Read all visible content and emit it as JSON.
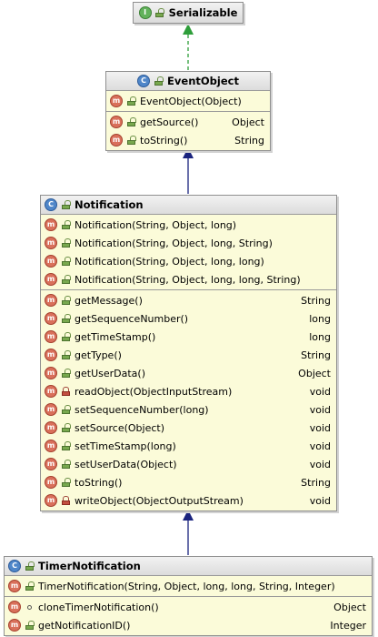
{
  "colors": {
    "box_bg": "#fbfbd9",
    "extends_arrow": "#1a237e",
    "implements_arrow": "#2e9e3a"
  },
  "serializable": {
    "title": "Serializable",
    "kind": "interface"
  },
  "event_object": {
    "title": "EventObject",
    "constructors": [
      {
        "name": "EventObject(Object)"
      }
    ],
    "methods": [
      {
        "name": "getSource()",
        "type": "Object",
        "visibility": "public"
      },
      {
        "name": "toString()",
        "type": "String",
        "visibility": "public"
      }
    ]
  },
  "notification": {
    "title": "Notification",
    "constructors": [
      {
        "name": "Notification(String, Object, long)"
      },
      {
        "name": "Notification(String, Object, long, String)"
      },
      {
        "name": "Notification(String, Object, long, long)"
      },
      {
        "name": "Notification(String, Object, long, long, String)"
      }
    ],
    "methods": [
      {
        "name": "getMessage()",
        "type": "String",
        "visibility": "public"
      },
      {
        "name": "getSequenceNumber()",
        "type": "long",
        "visibility": "public"
      },
      {
        "name": "getTimeStamp()",
        "type": "long",
        "visibility": "public"
      },
      {
        "name": "getType()",
        "type": "String",
        "visibility": "public"
      },
      {
        "name": "getUserData()",
        "type": "Object",
        "visibility": "public"
      },
      {
        "name": "readObject(ObjectInputStream)",
        "type": "void",
        "visibility": "private"
      },
      {
        "name": "setSequenceNumber(long)",
        "type": "void",
        "visibility": "public"
      },
      {
        "name": "setSource(Object)",
        "type": "void",
        "visibility": "public"
      },
      {
        "name": "setTimeStamp(long)",
        "type": "void",
        "visibility": "public"
      },
      {
        "name": "setUserData(Object)",
        "type": "void",
        "visibility": "public"
      },
      {
        "name": "toString()",
        "type": "String",
        "visibility": "public"
      },
      {
        "name": "writeObject(ObjectOutputStream)",
        "type": "void",
        "visibility": "private"
      }
    ]
  },
  "timer_notification": {
    "title": "TimerNotification",
    "constructors": [
      {
        "name": "TimerNotification(String, Object, long, long, String, Integer)"
      }
    ],
    "methods": [
      {
        "name": "cloneTimerNotification()",
        "type": "Object",
        "visibility": "package"
      },
      {
        "name": "getNotificationID()",
        "type": "Integer",
        "visibility": "public"
      }
    ]
  }
}
